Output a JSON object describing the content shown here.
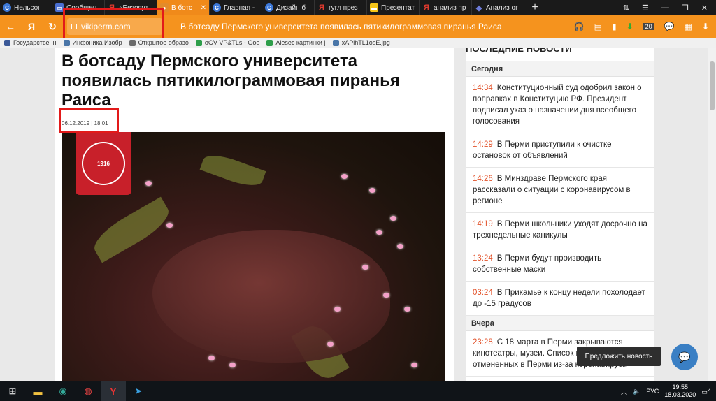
{
  "tabs": [
    {
      "label": "Нельсон",
      "icon": "c"
    },
    {
      "label": "Сообщен",
      "icon": "f"
    },
    {
      "label": "«Безовут",
      "icon": "y"
    },
    {
      "label": "В ботс",
      "icon": "o",
      "active": true
    },
    {
      "label": "Главная -",
      "icon": "c"
    },
    {
      "label": "Дизайн б",
      "icon": "c"
    },
    {
      "label": "гугл през",
      "icon": "y"
    },
    {
      "label": "Презентат",
      "icon": "g"
    },
    {
      "label": "анализ пр",
      "icon": "y"
    },
    {
      "label": "Анализ ог",
      "icon": "d"
    }
  ],
  "address": {
    "url": "vikiperm.com",
    "yandex_glyph": "Я",
    "title": "В ботсаду Пермского университета появилась пятикилограммовая пиранья Раиса",
    "badge_count": "20"
  },
  "bookmarks": [
    {
      "label": "Государственн",
      "color": "#3b5998"
    },
    {
      "label": "Инфоника Изобр",
      "color": "#4a76a8"
    },
    {
      "label": "Открытое образо",
      "color": "#6b6b6b"
    },
    {
      "label": "oGV VP&TLs - Goo",
      "color": "#2e9e4a"
    },
    {
      "label": "Aiesec картинки |",
      "color": "#2e9e4a"
    },
    {
      "label": "xAPlhTL1osE.jpg",
      "color": "#4a76a8"
    }
  ],
  "article": {
    "headline": "В ботсаду Пермского университета появилась пятикилограммовая пиранья Раиса",
    "date": "06.12.2019 | 18:01",
    "logo_year": "1916"
  },
  "sidebar": {
    "heading": "ПОСЛЕДНИЕ НОВОСТИ",
    "today_label": "Сегодня",
    "yesterday_label": "Вчера",
    "today": [
      {
        "time": "14:34",
        "text": "Конституционный суд одобрил закон о поправках в Конституцию РФ. Президент подписал указ о назначении дня всеобщего голосования"
      },
      {
        "time": "14:29",
        "text": "В Перми приступили к очистке остановок от объявлений"
      },
      {
        "time": "14:26",
        "text": "В Минздраве Пермского края рассказали о ситуации с коронавирусом в регионе"
      },
      {
        "time": "14:19",
        "text": "В Перми школьники уходят досрочно на трехнедельные каникулы"
      },
      {
        "time": "13:24",
        "text": "В Перми будут производить собственные маски"
      },
      {
        "time": "03:24",
        "text": "В Прикамье к концу недели похолодает до -15 градусов"
      }
    ],
    "yesterday": [
      {
        "time": "23:28",
        "text": "С 18 марта в Перми закрываются кинотеатры, музеи. Список мероприятий, отмененных в Перми из-за коронавируса"
      }
    ]
  },
  "suggest_label": "Предложить новость",
  "taskbar": {
    "lang": "РУС",
    "time": "19:55",
    "date": "18.03.2020",
    "notif_count": "2"
  }
}
